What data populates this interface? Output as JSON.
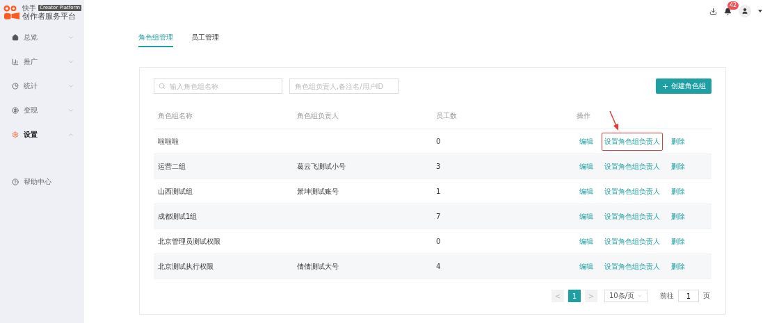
{
  "logo": {
    "brand": "快手",
    "badge": "Creator Platform",
    "title": "创作者服务平台"
  },
  "sidebar": {
    "items": [
      {
        "label": "总览",
        "selected": false,
        "expanded": false
      },
      {
        "label": "推广",
        "selected": false,
        "expanded": false
      },
      {
        "label": "统计",
        "selected": false,
        "expanded": false
      },
      {
        "label": "变现",
        "selected": false,
        "expanded": false
      },
      {
        "label": "设置",
        "selected": true,
        "expanded": true
      },
      {
        "label": "帮助中心",
        "selected": false
      }
    ]
  },
  "header": {
    "notifications": "42"
  },
  "tabs": [
    {
      "label": "角色组管理",
      "selected": true
    },
    {
      "label": "员工管理",
      "selected": false
    }
  ],
  "filters": {
    "name_placeholder": "输入角色组名称",
    "owner_placeholder": "角色组负责人,备注名/用户ID"
  },
  "create_button": "创建角色组",
  "table": {
    "columns": [
      "角色组名称",
      "角色组负责人",
      "员工数",
      "操作"
    ],
    "rows": [
      {
        "name": "啦啦啦",
        "count": "0",
        "actions": [
          "编辑",
          "设置角色组负责人",
          "删除"
        ],
        "highlighted": true
      },
      {
        "name": "运营二组",
        "owner": "葛云飞测试小号",
        "count": "3",
        "actions": [
          "编辑",
          "设置角色组负责人",
          "删除"
        ],
        "highlighted": false
      },
      {
        "name": "山西测试组",
        "owner": "景坤测试账号",
        "count": "1",
        "actions": [
          "编辑",
          "设置角色组负责人",
          "删除"
        ],
        "highlighted": false
      },
      {
        "name": "成都测试1组",
        "count": "7",
        "actions": [
          "编辑",
          "设置角色组负责人",
          "删除"
        ],
        "highlighted": false
      },
      {
        "name": "北京管理员测试权限",
        "count": "0",
        "actions": [
          "编辑",
          "设置角色组负责人",
          "删除"
        ],
        "highlighted": false
      },
      {
        "name": "北京测试执行权限",
        "owner": "倩倩测试大号",
        "count": "4",
        "actions": [
          "编辑",
          "设置角色组负责人",
          "删除"
        ],
        "highlighted": false
      }
    ]
  },
  "pagination": {
    "prev": "<",
    "pages": [
      {
        "label": "1",
        "selected": true
      }
    ],
    "next": ">",
    "page_size": "10条/页",
    "goto_label": "前往",
    "goto_value": "1",
    "goto_suffix": "页"
  }
}
